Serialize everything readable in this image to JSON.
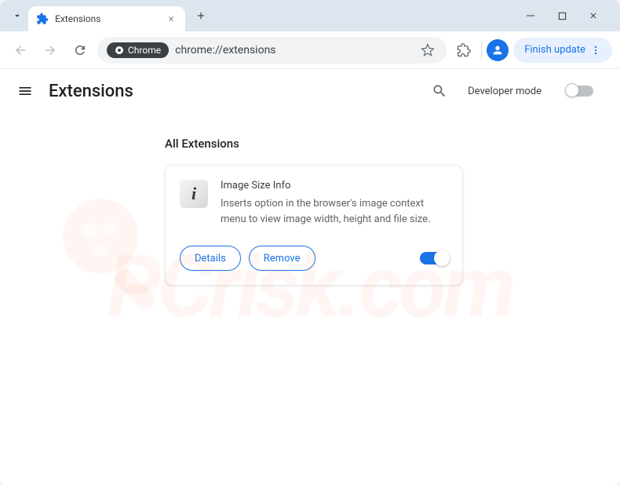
{
  "tab": {
    "title": "Extensions"
  },
  "omnibox": {
    "chip": "Chrome",
    "url": "chrome://extensions"
  },
  "toolbar": {
    "finish_update": "Finish update"
  },
  "page": {
    "title": "Extensions",
    "dev_mode_label": "Developer mode",
    "section_title": "All Extensions"
  },
  "extension": {
    "name": "Image Size Info",
    "description": "Inserts option in the browser's image context menu to view image width, height and file size.",
    "details_label": "Details",
    "remove_label": "Remove",
    "enabled": true
  },
  "watermark": "PCrisk.com"
}
